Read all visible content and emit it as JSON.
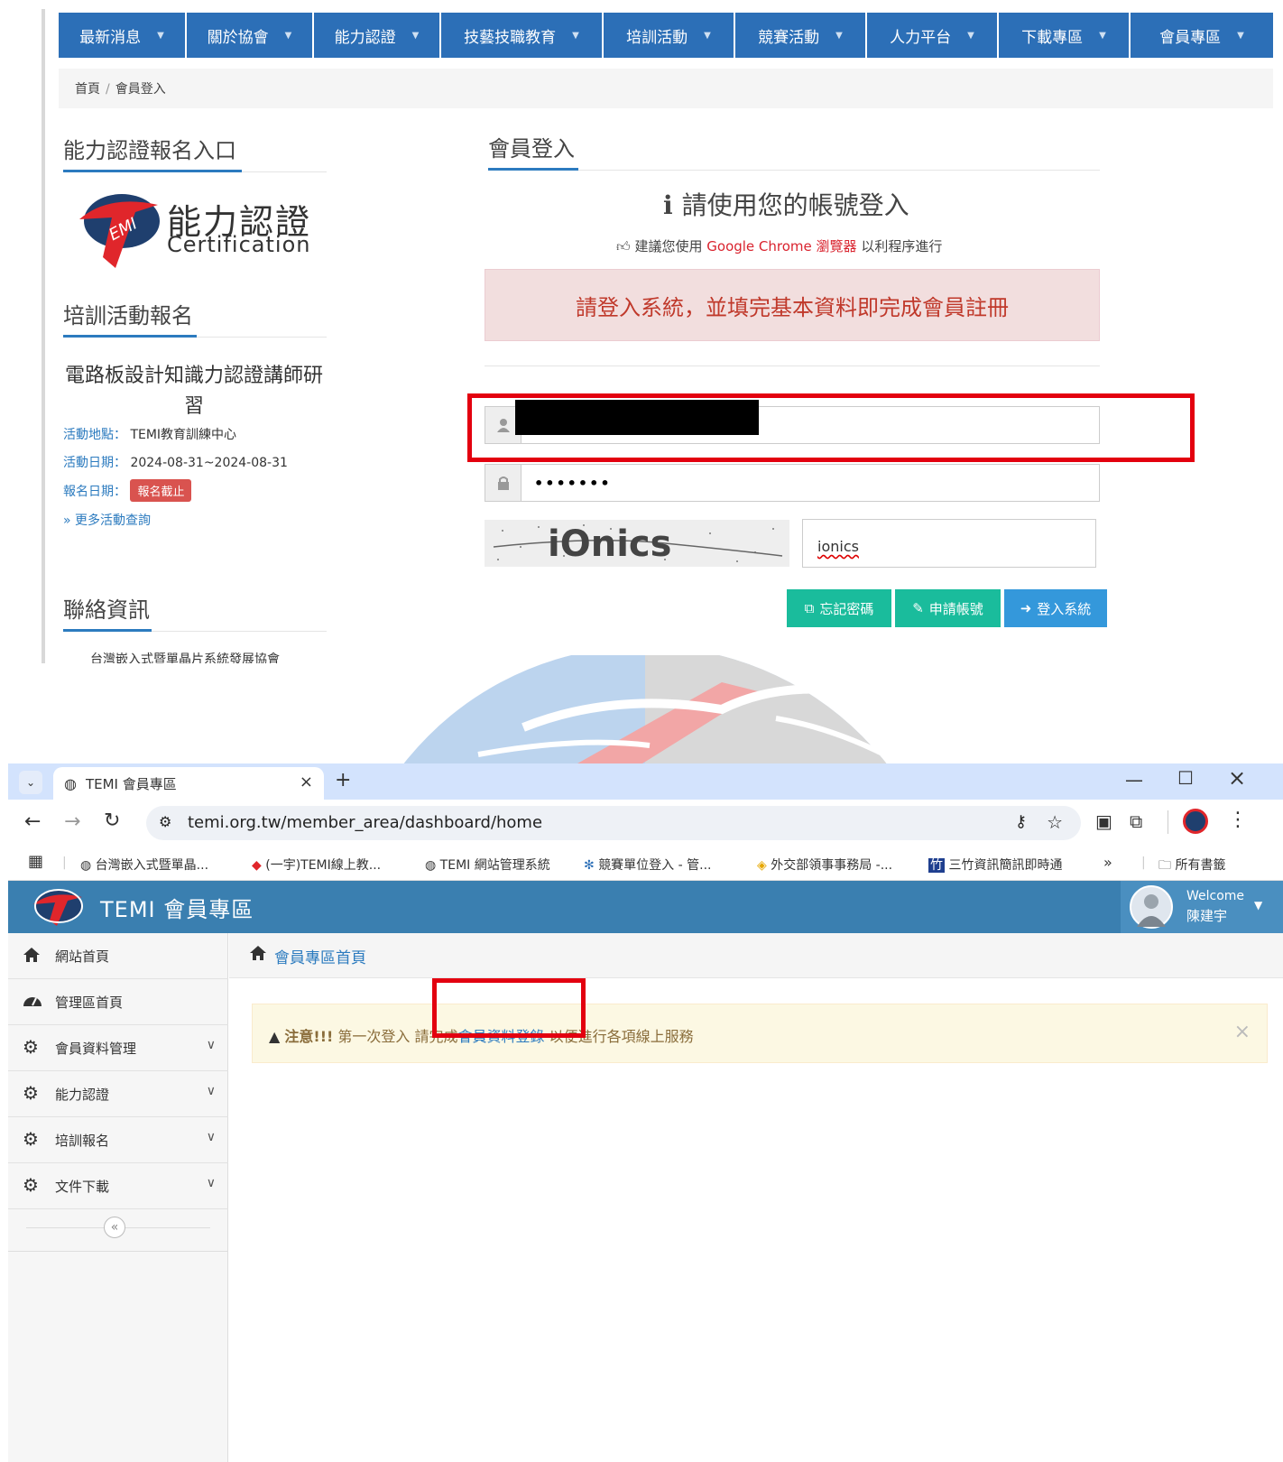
{
  "top": {
    "nav": [
      {
        "label": "最新消息"
      },
      {
        "label": "關於協會"
      },
      {
        "label": "能力認證"
      },
      {
        "label": "技藝技職教育"
      },
      {
        "label": "培訓活動"
      },
      {
        "label": "競賽活動"
      },
      {
        "label": "人力平台"
      },
      {
        "label": "下載專區"
      },
      {
        "label": "會員專區"
      }
    ],
    "breadcrumb": {
      "home": "首頁",
      "sep": "/",
      "current": "會員登入"
    },
    "sidebar": {
      "cert_title": "能力認證報名入口",
      "logo_cn": "能力認證",
      "logo_en": "Certification",
      "training_title": "培訓活動報名",
      "event_title": "電路板設計知識力認證講師研習",
      "location_key": "活動地點：",
      "location_val": "TEMI教育訓練中心",
      "date_key": "活動日期：",
      "date_val": "2024-08-31~2024-08-31",
      "signup_key": "報名日期：",
      "signup_badge": "報名截止",
      "more": "» 更多活動查詢",
      "contact_title": "聯絡資訊",
      "org_cut": "台灣嵌入式暨單晶片系統發展協會"
    },
    "login": {
      "title": "會員登入",
      "info": "請使用您的帳號登入",
      "tip_pre": "建議您使用",
      "tip_red": "Google Chrome 瀏覽器",
      "tip_post": "以利程序進行",
      "alert": "請登入系統，並填完基本資料即完成會員註冊",
      "password": "•••••••",
      "captcha_text": "iOnics",
      "captcha_value": "ionics",
      "btn_forgot": "忘記密碼",
      "btn_apply": "申請帳號",
      "btn_login": "登入系統"
    }
  },
  "browser": {
    "tab_title": "TEMI 會員專區",
    "new_tab": "+",
    "url": "temi.org.tw/member_area/dashboard/home",
    "bookmarks": [
      {
        "label": "台灣嵌入式暨單晶..."
      },
      {
        "label": "(一宇)TEMI線上教..."
      },
      {
        "label": "TEMI 網站管理系統"
      },
      {
        "label": "競賽單位登入 - 管..."
      },
      {
        "label": "外交部領事事務局 -..."
      },
      {
        "label": "三竹資訊簡訊即時通"
      },
      {
        "label": "»"
      },
      {
        "label": "所有書籤"
      }
    ],
    "app_title": "TEMI 會員專區",
    "welcome": "Welcome",
    "username": "陳建宇",
    "sidebar": [
      {
        "label": "網站首頁",
        "icon": "home-icon"
      },
      {
        "label": "管理區首頁",
        "icon": "dashboard-icon"
      },
      {
        "label": "會員資料管理",
        "icon": "gear-icon"
      },
      {
        "label": "能力認證",
        "icon": "gear-icon"
      },
      {
        "label": "培訓報名",
        "icon": "gear-icon"
      },
      {
        "label": "文件下載",
        "icon": "gear-icon"
      }
    ],
    "collapse": "«",
    "content_title": "會員專區首頁",
    "warn_prefix": "注意!!!",
    "warn_1": "第一次登入 請完成",
    "warn_link": "會員資料登錄",
    "warn_2": "以便進行各項線上服務",
    "warn_close": "×",
    "colors": {
      "header": "#3a7fb0",
      "nav": "#2c6fb7",
      "highlight": "#e3000f"
    }
  }
}
